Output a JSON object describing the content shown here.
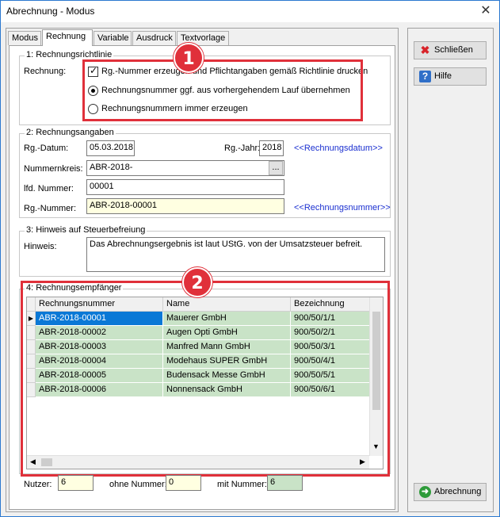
{
  "window": {
    "title": "Abrechnung - Modus",
    "close_glyph": "✕"
  },
  "tabs": [
    "Modus",
    "Rechnung",
    "Variable",
    "Ausdruck",
    "Textvorlage"
  ],
  "section1": {
    "legend": "1: Rechnungsrichtlinie",
    "label": "Rechnung:",
    "checkbox_label": "Rg.-Nummer erzeugen und Pflichtangaben gemäß Richtlinie drucken",
    "radio1_label": "Rechnungsnummer ggf. aus vorhergehendem Lauf übernehmen",
    "radio2_label": "Rechnungsnummern immer erzeugen"
  },
  "section2": {
    "legend": "2: Rechnungsangaben",
    "rg_datum_label": "Rg.-Datum:",
    "rg_datum_value": "05.03.2018",
    "rg_jahr_label": "Rg.-Jahr:",
    "rg_jahr_value": "2018",
    "rg_datum_link": "<<Rechnungsdatum>>",
    "nummernkreis_label": "Nummernkreis:",
    "nummernkreis_value": "ABR-2018-",
    "browse_label": "...",
    "lfd_label": "lfd. Nummer:",
    "lfd_value": "00001",
    "rg_nummer_label": "Rg.-Nummer:",
    "rg_nummer_value": "ABR-2018-00001",
    "rg_nummer_link": "<<Rechnungsnummer>>"
  },
  "section3": {
    "legend": "3: Hinweis auf Steuerbefreiung",
    "label": "Hinweis:",
    "text": "Das Abrechnungsergebnis ist laut UStG. von der Umsatzsteuer befreit."
  },
  "section4": {
    "legend": "4: Rechnungsempfänger",
    "columns": [
      "Rechnungsnummer",
      "Name",
      "Bezeichnung"
    ],
    "rows": [
      [
        "ABR-2018-00001",
        "Mauerer GmbH",
        "900/50/1/1"
      ],
      [
        "ABR-2018-00002",
        "Augen Opti GmbH",
        "900/50/2/1"
      ],
      [
        "ABR-2018-00003",
        "Manfred Mann GmbH",
        "900/50/3/1"
      ],
      [
        "ABR-2018-00004",
        "Modehaus SUPER GmbH",
        "900/50/4/1"
      ],
      [
        "ABR-2018-00005",
        "Budensack Messe GmbH",
        "900/50/5/1"
      ],
      [
        "ABR-2018-00006",
        "Nonnensack GmbH",
        "900/50/6/1"
      ]
    ],
    "selected_row": 0,
    "row_indicator": "▶"
  },
  "footer": {
    "nutzer_label": "Nutzer:",
    "nutzer_value": "6",
    "ohne_label": "ohne Nummer:",
    "ohne_value": "0",
    "mit_label": "mit Nummer:",
    "mit_value": "6"
  },
  "buttons": {
    "schliessen": "Schließen",
    "hilfe": "Hilfe",
    "abrechnung": "Abrechnung"
  },
  "badges": [
    "1",
    "2"
  ],
  "colors": {
    "highlight": "#e0303a",
    "selection": "#0a78d6",
    "row_green": "#c9e3c7",
    "link": "#1a2fd0"
  },
  "icons": {
    "close": "close-icon",
    "schliessen": "red-x-icon",
    "hilfe": "help-icon",
    "abrechnung": "green-arrow-icon"
  }
}
